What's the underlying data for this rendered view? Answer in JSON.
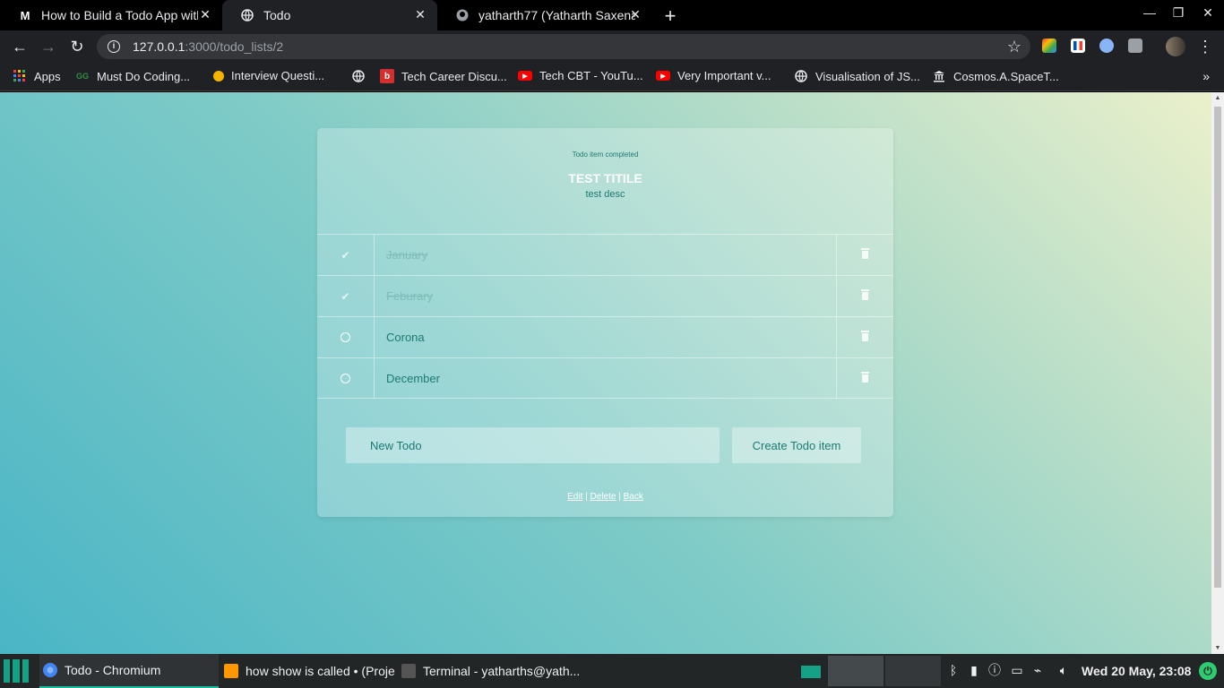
{
  "browser": {
    "tabs": [
      {
        "title": "How to Build a Todo App with",
        "favicon": "M",
        "active": false
      },
      {
        "title": "Todo",
        "favicon": "globe-icon",
        "active": true
      },
      {
        "title": "yatharth77 (Yatharth Saxena)",
        "favicon": "github-icon",
        "active": false
      }
    ],
    "url_host": "127.0.0.1",
    "url_path": ":3000/todo_lists/2",
    "bookmarks": [
      {
        "label": "Apps",
        "icon": "apps-grid-icon"
      },
      {
        "label": "Must Do Coding...",
        "icon": "gfg-icon"
      },
      {
        "label": "Interview Questi...",
        "icon": "interview-icon"
      },
      {
        "label": "",
        "icon": "globe-icon"
      },
      {
        "label": "Tech Career Discu...",
        "icon": "b-icon"
      },
      {
        "label": "Tech CBT - YouTu...",
        "icon": "youtube-icon"
      },
      {
        "label": "Very Important v...",
        "icon": "youtube-icon"
      },
      {
        "label": "Visualisation of JS...",
        "icon": "globe-icon"
      },
      {
        "label": "Cosmos.A.SpaceT...",
        "icon": "museum-icon"
      }
    ]
  },
  "page": {
    "notice": "Todo item completed",
    "list_title": "TEST TITILE",
    "list_description": "test desc",
    "items": [
      {
        "text": "January",
        "completed": true
      },
      {
        "text": "Feburary",
        "completed": true
      },
      {
        "text": "Corona",
        "completed": false
      },
      {
        "text": "December",
        "completed": false
      }
    ],
    "new_todo_placeholder": "New Todo",
    "create_button": "Create Todo item",
    "links": {
      "edit": "Edit",
      "delete": "Delete",
      "back": "Back",
      "separator": "|"
    }
  },
  "taskbar": {
    "items": [
      {
        "label": "Todo - Chromium",
        "active": true
      },
      {
        "label": "how show is called • (Proje...",
        "active": false
      },
      {
        "label": "Terminal - yatharths@yath...",
        "active": false
      }
    ],
    "clock": "Wed 20 May, 23:08"
  },
  "colors": {
    "accent_teal": "#1d7a74",
    "taskbar_accent": "#1abc9c"
  }
}
